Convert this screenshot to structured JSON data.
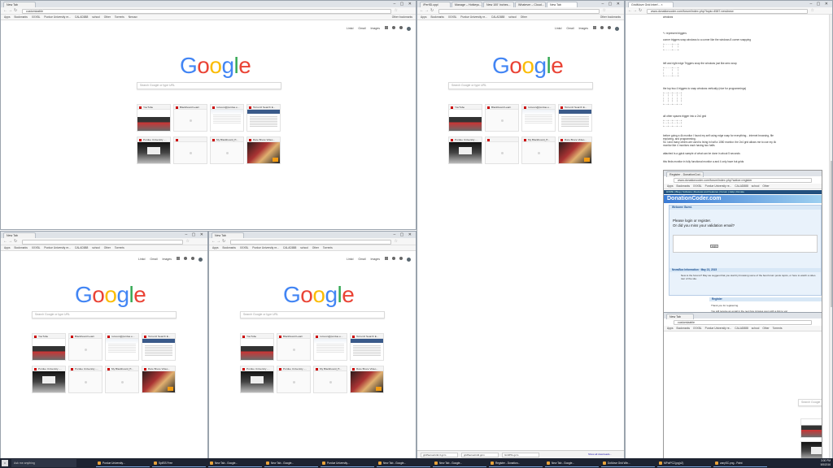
{
  "taskbar": {
    "search_placeholder": "Ask me anything",
    "items": [
      "Purdue University...",
      "SpilSS Free",
      "New Tab - Google...",
      "New Tab - Google...",
      "Purdue University...",
      "New Tab - Google...",
      "New Tab - Google...",
      "Register - Donation...",
      "New Tab - Google...",
      "DoMove Grid Win...",
      "MPotPC2.jpg(c2)",
      "zanySC.png - Paint"
    ],
    "clock": "3:00 PM",
    "date": "5/5/2016"
  },
  "top_left": {
    "tab_label": "New Tab",
    "omnibox_value": "customizable",
    "bookmarks": [
      "Apps",
      "Bookmarks",
      "XXXBL",
      "Purdue University re...",
      "CALAD888",
      "school",
      "Other",
      "Torrents",
      "Nexusv"
    ],
    "other_bookmarks": "Other bookmarks",
    "header_links": [
      "Linkd",
      "Gmail",
      "Images"
    ],
    "logo": "Google",
    "search_placeholder": "Search Google or type URL",
    "tiles": [
      {
        "title": "YouTube",
        "kind": "yt"
      },
      {
        "title": "Blackboard Learn",
        "kind": "blank"
      },
      {
        "title": "rumoun@purdue.e...",
        "kind": "gmail"
      },
      {
        "title": "Torrentz Search E...",
        "kind": "tor"
      },
      {
        "title": "Purdue University -...",
        "kind": "purdue"
      },
      {
        "title": "",
        "kind": "blank"
      },
      {
        "title": "My Blackboard_H...",
        "kind": "blank"
      },
      {
        "title": "Rare Bruce Video...",
        "kind": "movie"
      }
    ]
  },
  "top_right": {
    "tabs": [
      "\\PerfID.cpp\\",
      "Manage – Hotkeys...",
      "New 100' Inches...",
      "Whatever – Cloud...",
      "New Tab"
    ],
    "omnibox_value": "",
    "bookmarks": [
      "Apps",
      "Bookmarks",
      "XXXBL",
      "Purdue University re...",
      "CALAD888",
      "school",
      "Other",
      "Torrents",
      "Nexusv"
    ],
    "other_bookmarks": "Other bookmarks",
    "header_links": [
      "Linkd",
      "Gmail",
      "Images"
    ],
    "logo": "Google",
    "search_placeholder": "Search Google or type URL",
    "tiles": [
      {
        "title": "YouTube",
        "kind": "yt"
      },
      {
        "title": "Blackboard Learn",
        "kind": "blank"
      },
      {
        "title": "rumoun@purdue.e...",
        "kind": "gmail"
      },
      {
        "title": "Torrentz Search E...",
        "kind": "tor"
      },
      {
        "title": "Purdue University -...",
        "kind": "purdue"
      },
      {
        "title": "",
        "kind": "blank"
      },
      {
        "title": "My Blackboard_H...",
        "kind": "blank"
      },
      {
        "title": "Rare Bruce Video...",
        "kind": "movie"
      }
    ],
    "downloads": [
      "gridSenseGrid-3.gcm",
      "gridSenseGrid.gcm",
      "GridPIG.gcm"
    ],
    "show_all_downloads": "Show all downloads..."
  },
  "bottom_left": {
    "tab_label": "New Tab",
    "omnibox_value": "",
    "bookmarks": [
      "Apps",
      "Bookmarks",
      "XXXBL",
      "Purdue University re...",
      "CALAD888",
      "school",
      "Other",
      "Torrents",
      "Nexusv"
    ],
    "other_bookmarks": "Other bookmarks",
    "header_links": [
      "Linkd",
      "Gmail",
      "Images"
    ],
    "logo": "Google",
    "search_placeholder": "Search Google or type URL",
    "tiles": [
      {
        "title": "YouTube",
        "kind": "yt"
      },
      {
        "title": "Blackboard Learn",
        "kind": "blank"
      },
      {
        "title": "rumoun@purdue.e...",
        "kind": "gmail"
      },
      {
        "title": "Torrentz Search E...",
        "kind": "tor"
      },
      {
        "title": "Purdue University -...",
        "kind": "purdue"
      },
      {
        "title": "Purdue University -...",
        "kind": "blank"
      },
      {
        "title": "My Blackboard_H...",
        "kind": "blank"
      },
      {
        "title": "Rare Bruce Video...",
        "kind": "movie"
      }
    ]
  },
  "bottom_mid": {
    "tab_label": "New Tab",
    "omnibox_value": "",
    "bookmarks": [
      "Apps",
      "Bookmarks",
      "XXXBL",
      "Purdue University re...",
      "CALAD888",
      "school",
      "Other",
      "Torrents",
      "Nexusv"
    ],
    "other_bookmarks": "Other bookmarks",
    "header_links": [
      "Linkd",
      "Gmail",
      "Images"
    ],
    "logo": "Google",
    "search_placeholder": "Search Google or type URL",
    "tiles": [
      {
        "title": "YouTube",
        "kind": "yt"
      },
      {
        "title": "Blackboard Learn",
        "kind": "blank"
      },
      {
        "title": "rumoun@purdue.e...",
        "kind": "gmail"
      },
      {
        "title": "Torrentz Search E...",
        "kind": "tor"
      },
      {
        "title": "Purdue University -...",
        "kind": "purdue"
      },
      {
        "title": "Purdue University -...",
        "kind": "blank"
      },
      {
        "title": "My Blackboard_H...",
        "kind": "blank"
      },
      {
        "title": "Rare Bruce Video...",
        "kind": "movie"
      }
    ]
  },
  "right_window": {
    "tab_label": "GridMove Grid Interf... ×",
    "omnibox_value": "www.donationcoder.com/forum/index.php?topic=4587.new#new",
    "doc_lines": [
      "windows",
      "*= represent triggers",
      "corner triggers snap windows to a corner like the windows 8 corner snapping",
      "left and right edge Triggers snap the windows just like aero snap",
      "the top two 4 triggers to snap windows vertically (nice for programmings)",
      "all other spaces trigger into a 2x4 grid",
      "before going a 4k monitor I found my self using edge snap for everything... internet browsing, file",
      "exploring, and programming.",
      "So I and many others are used to living in half a 1080 monitor. the 2x4 grid allows me to use my 4k",
      "monitor like 4 monitors each having two halfs",
      "attached is a gpick sample of what can be done in about 5 seconds",
      "this finds monitor in fully functional monitor a and 4 only have but grids"
    ],
    "inset": {
      "tab": "Register - DonationCod...",
      "url": "www.donationcoder.com/forum/index.php?action=register",
      "site_links": "HOME | Blog | Software | Reviews and Features | Forum | Help | Donate",
      "header": "DonationCoder.com",
      "welcome": "Welcome Guest.",
      "login_prompt": "Please login or register.",
      "missed_prompt": "Or did you miss your validation email?",
      "login_button": "Login",
      "news_header": "NewsBox Information · May 23, 2015",
      "news_text": "New to the forums? May we suggest that you start by browsing some of the best forum posts topics, or here to watch a video tour of the site.",
      "register_header": "Register",
      "register_text": "Thank you for registering.",
      "register_text2": "You will receive an email in the next few minutes soon with a link to val"
    },
    "inner_tab": "New Tab",
    "inner_omnibox": "customizable",
    "inner_search_placeholder": "Search Google"
  }
}
